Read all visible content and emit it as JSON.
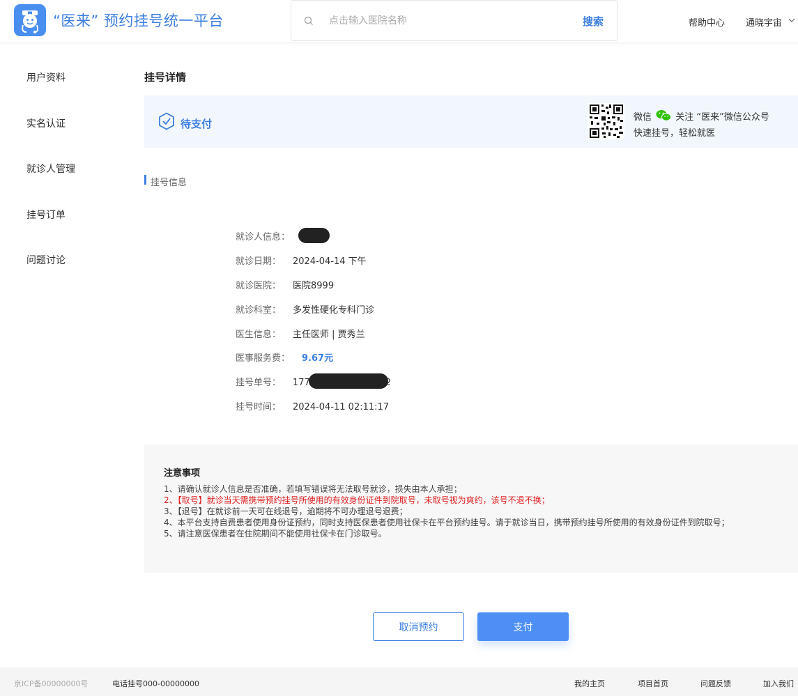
{
  "header": {
    "brand": "“医来” 预约挂号统一平台",
    "search_placeholder": "点击输入医院名称",
    "search_button": "搜索",
    "help": "帮助中心",
    "user": "通晓宇宙"
  },
  "sidebar": {
    "items": [
      {
        "label": "用户资料"
      },
      {
        "label": "实名认证"
      },
      {
        "label": "就诊人管理"
      },
      {
        "label": "挂号订单"
      },
      {
        "label": "问题讨论"
      }
    ]
  },
  "main": {
    "title": "挂号详情",
    "status": "待支付",
    "wechat_line1_a": "微信",
    "wechat_line1_b": "关注 “医来”微信公众号",
    "wechat_line2": "快速挂号，轻松就医",
    "section_title": "挂号信息",
    "info": {
      "patient_label": "就诊人信息：",
      "date_label": "就诊日期：",
      "date_value": "2024-04-14 下午",
      "hospital_label": "就诊医院：",
      "hospital_value": "医院8999",
      "dept_label": "就诊科室：",
      "dept_value": "多发性硬化专科门诊",
      "doctor_label": "医生信息：",
      "doctor_value": "主任医师 | 贾秀兰",
      "fee_label": "医事服务费：",
      "fee_value": "9.67元",
      "order_label": "挂号单号：",
      "order_value_prefix": "177",
      "order_value_suffix": "2",
      "time_label": "挂号时间：",
      "time_value": "2024-04-11 02:11:17"
    },
    "notice": {
      "title": "注意事项",
      "line1": "1、请确认就诊人信息是否准确，若填写错误将无法取号就诊，损失由本人承担；",
      "line2": "2、【取号】就诊当天需携带预约挂号所使用的有效身份证件到院取号，未取号视为爽约，该号不退不换；",
      "line3": "3、【退号】在就诊前一天可在线退号，逾期将不可办理退号退费；",
      "line4": "4、本平台支持自费患者使用身份证预约，同时支持医保患者使用社保卡在平台预约挂号。请于就诊当日，携带预约挂号所使用的有效身份证件到院取号；",
      "line5": "5、请注意医保患者在住院期间不能使用社保卡在门诊取号。"
    },
    "cancel_button": "取消预约",
    "pay_button": "支付"
  },
  "footer": {
    "icp": "京ICP备00000000号",
    "phone": "电话挂号000-00000000",
    "links": [
      "我的主页",
      "项目首页",
      "问题反馈",
      "加入我们"
    ]
  },
  "colors": {
    "accent": "#3b7ee0",
    "pay_button": "#4d8ff5",
    "status_bg": "#f2f7fd",
    "notice_bg": "#f7f7f7",
    "warning": "#e02020"
  },
  "icons": [
    "logo-icon",
    "search-icon",
    "chevron-down-icon",
    "shield-check-icon",
    "qr-code-icon",
    "wechat-icon"
  ]
}
